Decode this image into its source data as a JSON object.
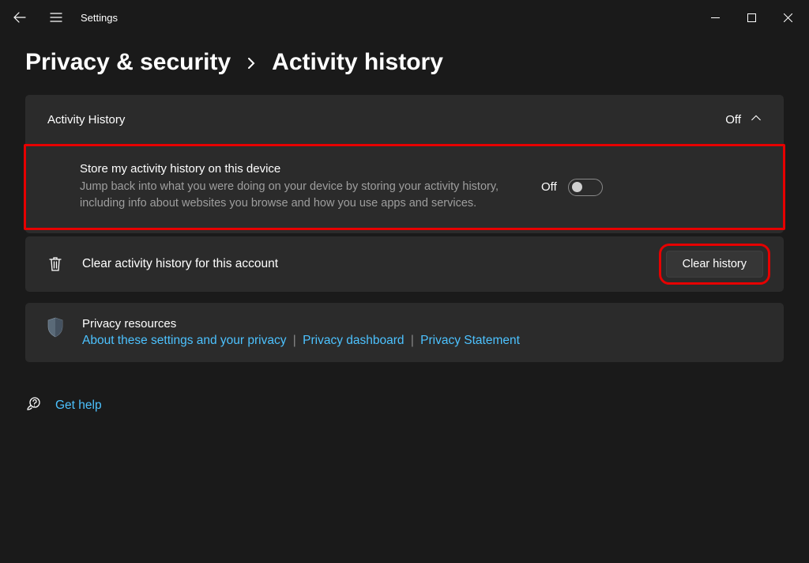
{
  "app": {
    "title": "Settings"
  },
  "breadcrumb": {
    "parent": "Privacy & security",
    "current": "Activity history"
  },
  "activity_panel": {
    "title": "Activity History",
    "status": "Off",
    "detail": {
      "title": "Store my activity history on this device",
      "desc": "Jump back into what you were doing on your device by storing your activity history, including info about websites you browse and how you use apps and services.",
      "toggle_label": "Off"
    }
  },
  "clear_row": {
    "label": "Clear activity history for this account",
    "button": "Clear history"
  },
  "resources": {
    "title": "Privacy resources",
    "links": {
      "about": "About these settings and your privacy",
      "dashboard": "Privacy dashboard",
      "statement": "Privacy Statement"
    }
  },
  "help": {
    "label": "Get help"
  }
}
